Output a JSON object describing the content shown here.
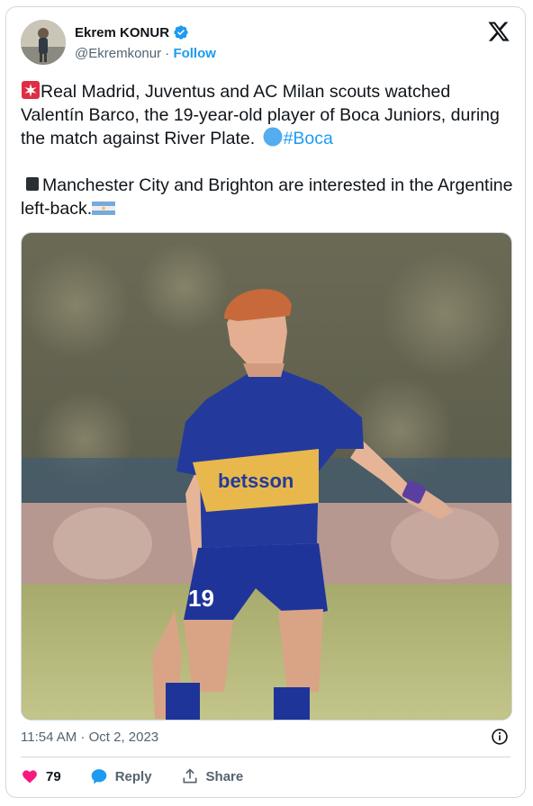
{
  "author": {
    "name": "Ekrem KONUR",
    "handle": "@Ekremkonur",
    "separator": "·",
    "follow_label": "Follow"
  },
  "tweet": {
    "line1": "Real Madrid, Juventus and AC Milan scouts watched Valentín Barco, the 19-year-old player of Boca Juniors, during the match against River Plate.",
    "hashtag": "#Boca",
    "line2": "Manchester City and Brighton are interested in the Argentine left-back."
  },
  "media": {
    "jersey_sponsor": "betsson",
    "shorts_number": "19"
  },
  "timestamp": "11:54 AM · Oct 2, 2023",
  "actions": {
    "like_count": "79",
    "reply_label": "Reply",
    "share_label": "Share"
  },
  "colors": {
    "accent": "#1d9bf0",
    "like": "#f91880",
    "muted": "#536471"
  },
  "icons": [
    "verified-badge-icon",
    "x-logo-icon",
    "siren-emoji",
    "black-square-emoji",
    "blue-circle-emoji",
    "argentina-flag-emoji",
    "info-icon",
    "heart-icon",
    "reply-bubble-icon",
    "share-icon"
  ]
}
